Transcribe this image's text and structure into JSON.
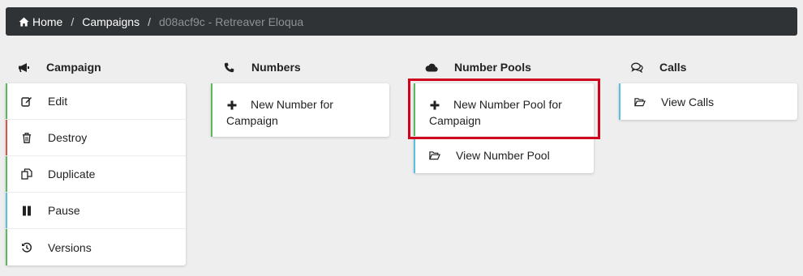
{
  "breadcrumb": {
    "home": "Home",
    "campaigns": "Campaigns",
    "current": "d08acf9c - Retreaver Eloqua",
    "separator": "/"
  },
  "columns": {
    "campaign": {
      "title": "Campaign",
      "icon": "bullhorn-icon",
      "items": [
        {
          "label": "Edit",
          "icon": "edit-icon",
          "accent": "#5cb85c"
        },
        {
          "label": "Destroy",
          "icon": "trash-icon",
          "accent": "#d9534f"
        },
        {
          "label": "Duplicate",
          "icon": "copy-icon",
          "accent": "#5cb85c"
        },
        {
          "label": "Pause",
          "icon": "pause-icon",
          "accent": "#5bc0de"
        },
        {
          "label": "Versions",
          "icon": "history-icon",
          "accent": "#5cb85c"
        }
      ]
    },
    "numbers": {
      "title": "Numbers",
      "icon": "phone-icon",
      "items": [
        {
          "label": "New Number for Campaign",
          "icon": "plus-icon",
          "accent": "#5cb85c"
        }
      ]
    },
    "number_pools": {
      "title": "Number Pools",
      "icon": "cloud-icon",
      "items": [
        {
          "label": "New Number Pool for Campaign",
          "icon": "plus-icon",
          "accent": "#5cb85c"
        },
        {
          "label": "View Number Pool",
          "icon": "folder-open-icon",
          "accent": "#5bc0de"
        }
      ]
    },
    "calls": {
      "title": "Calls",
      "icon": "comments-icon",
      "items": [
        {
          "label": "View Calls",
          "icon": "folder-open-icon",
          "accent": "#5bc0de"
        }
      ]
    }
  },
  "colors": {
    "breadcrumb_bg": "#2f3336",
    "highlight_border": "#d0021b",
    "page_bg": "#eeeeee"
  }
}
